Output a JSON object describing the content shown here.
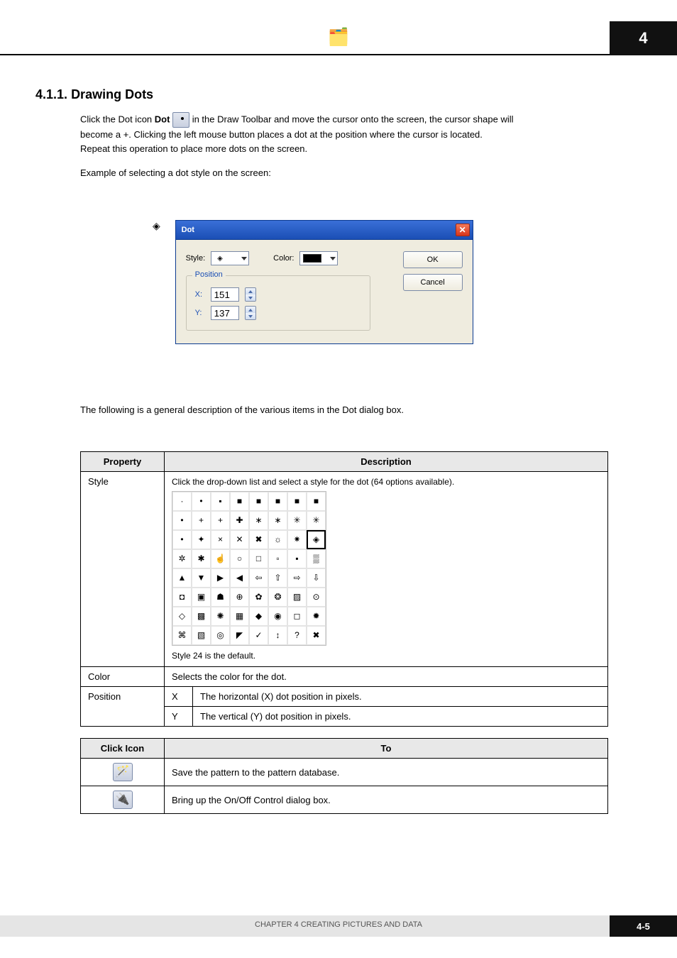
{
  "chapter": "4",
  "header_icon_label": "",
  "section_number": "4.1.1.",
  "section_title": "Drawing Dots",
  "intro_prefix": "Click the Dot icon ",
  "intro_suffix": " in the Draw Toolbar and move the cursor onto the screen, the cursor shape will",
  "intro_line2": "become a +. Clicking the left mouse button places a dot at the position where the cursor is located.",
  "intro_line3": "Repeat this operation to place more dots on the screen.",
  "dot_label": "Dot",
  "example_intro": "Example of selecting a dot style on the screen:",
  "dialog": {
    "title": "Dot",
    "style_label": "Style:",
    "color_label": "Color:",
    "position_label": "Position",
    "x_label": "X:",
    "y_label": "Y:",
    "x_value": "151",
    "y_value": "137",
    "ok": "OK",
    "cancel": "Cancel"
  },
  "below_dialog": "The following is a general description of the various items in the Dot dialog box.",
  "prop_table": {
    "col1": "Property",
    "col2": "Description",
    "rows": [
      {
        "prop": "Style",
        "desc1": "Click the drop-down list and select a style for the dot (64 options available).",
        "desc2": "Style 24 is the default."
      },
      {
        "prop": "Color",
        "desc": "Selects the color for the dot."
      },
      {
        "prop": "Position",
        "sub": [
          {
            "label": "X",
            "desc": "The horizontal (X) dot position in pixels."
          },
          {
            "label": "Y",
            "desc": "The vertical (Y) dot position in pixels."
          }
        ]
      }
    ]
  },
  "icon_table": {
    "col1": "Click Icon",
    "col2": "To",
    "rows": [
      {
        "icon": "pattern-icon",
        "desc": "Save the pattern to the pattern database."
      },
      {
        "icon": "on-off-icon",
        "desc": "Bring up the On/Off Control dialog box."
      }
    ]
  },
  "footer_text": "CHAPTER 4    CREATING PICTURES AND DATA",
  "page_no": "4-5"
}
